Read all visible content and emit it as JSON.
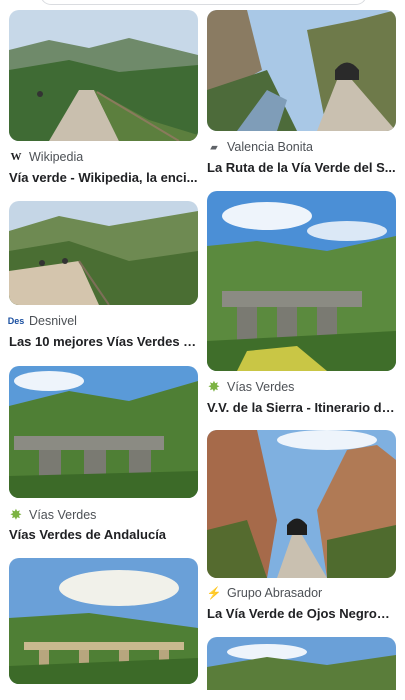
{
  "results": [
    {
      "source": "Wikipedia",
      "source_icon": "W",
      "title": "Vía verde - Wikipedia, la enci..."
    },
    {
      "source": "Valencia Bonita",
      "source_icon": "VB",
      "title": "La Ruta de la Vía Verde del S..."
    },
    {
      "source": "Desnivel",
      "source_icon": "Des",
      "title": "Las 10 mejores Vías Verdes -..."
    },
    {
      "source": "Vías Verdes",
      "source_icon": "VV",
      "title": "V.V. de la Sierra - Itinerario de..."
    },
    {
      "source": "Vías Verdes",
      "source_icon": "VV",
      "title": "Vías Verdes de Andalucía"
    },
    {
      "source": "Grupo Abrasador",
      "source_icon": "GA",
      "title": "La Vía Verde de Ojos Negros, ..."
    }
  ],
  "colors": {
    "accent_green": "#7cb342",
    "text": "#202124",
    "muted": "#4d5156"
  }
}
